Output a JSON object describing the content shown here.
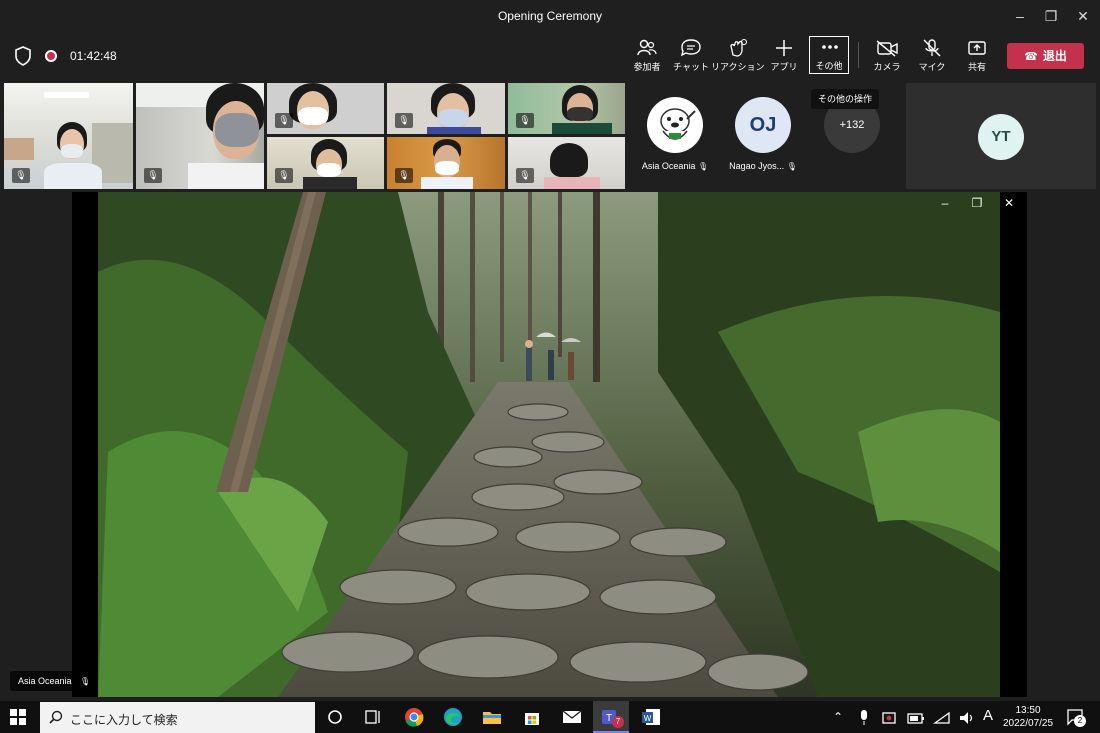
{
  "window": {
    "title": "Opening Ceremony",
    "minimize": "–",
    "maximize": "❐",
    "close": "✕"
  },
  "toolbar": {
    "timer": "01:42:48",
    "buttons": [
      {
        "label": "参加者",
        "icon": "people-icon"
      },
      {
        "label": "チャット",
        "icon": "chat-icon"
      },
      {
        "label": "リアクション",
        "icon": "reaction-icon"
      },
      {
        "label": "アプリ",
        "icon": "plus-icon"
      },
      {
        "label": "その他",
        "icon": "more-icon"
      },
      {
        "label": "カメラ",
        "icon": "camera-off-icon"
      },
      {
        "label": "マイク",
        "icon": "mic-off-icon"
      },
      {
        "label": "共有",
        "icon": "share-icon"
      }
    ],
    "leave_label": "退出",
    "more_tooltip": "その他の操作"
  },
  "gallery": {
    "avatars": [
      {
        "name": "Asia Oceania",
        "initials": ""
      },
      {
        "name": "Nagao Jyos...",
        "initials": "OJ"
      }
    ],
    "overflow_count": "+132",
    "spotlight_initials": "YT"
  },
  "stage": {
    "presenter_label": "Asia Oceania",
    "minimize": "–",
    "restore": "❐",
    "close": "✕"
  },
  "taskbar": {
    "search_placeholder": "ここに入力して検索",
    "teams_badge": "7",
    "time": "13:50",
    "date": "2022/07/25",
    "ime": "A",
    "notifications": "2"
  },
  "colors": {
    "leave": "#c4314b",
    "background": "#1f1f1f",
    "taskbar": "#101010"
  }
}
